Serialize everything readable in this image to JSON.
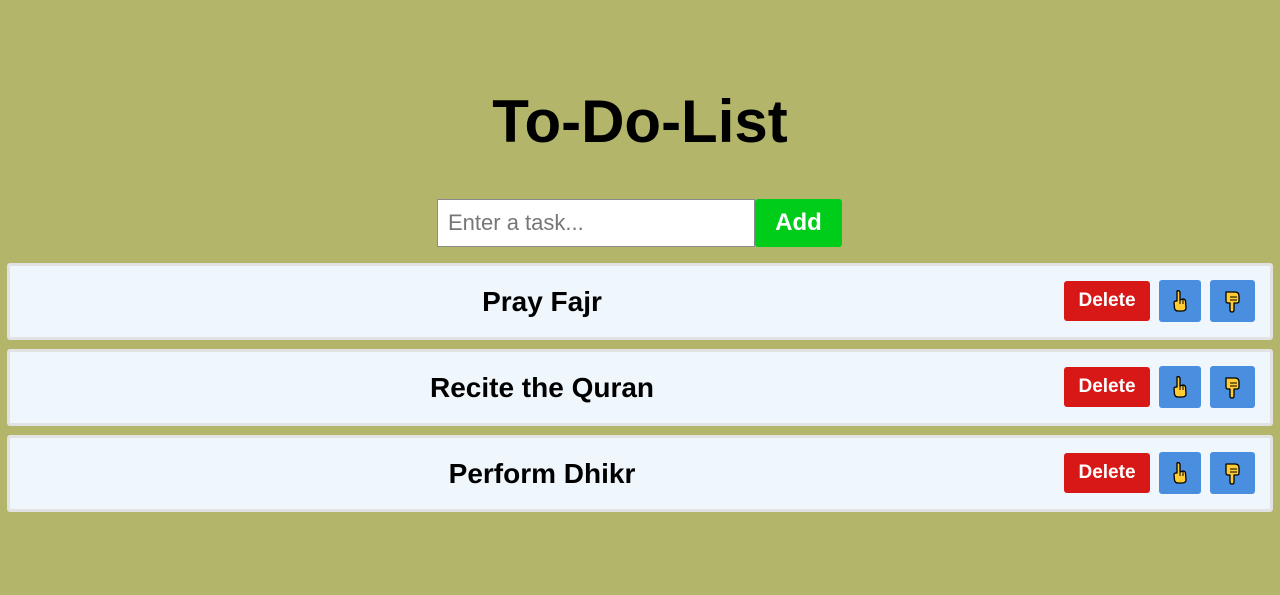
{
  "app": {
    "title": "To-Do-List"
  },
  "add_form": {
    "input_value": "",
    "input_placeholder": "Enter a task...",
    "add_label": "Add"
  },
  "tasks": [
    {
      "text": "Pray Fajr",
      "delete_label": "Delete",
      "up_icon": "hand-pointing-up-icon",
      "down_icon": "hand-pointing-down-icon"
    },
    {
      "text": "Recite the Quran",
      "delete_label": "Delete",
      "up_icon": "hand-pointing-up-icon",
      "down_icon": "hand-pointing-down-icon"
    },
    {
      "text": "Perform Dhikr",
      "delete_label": "Delete",
      "up_icon": "hand-pointing-up-icon",
      "down_icon": "hand-pointing-down-icon"
    }
  ],
  "colors": {
    "background": "#b3b66a",
    "add_button": "#00cc1a",
    "delete_button": "#d81717",
    "move_button": "#4a8ee0",
    "task_background": "#eff6fc"
  }
}
